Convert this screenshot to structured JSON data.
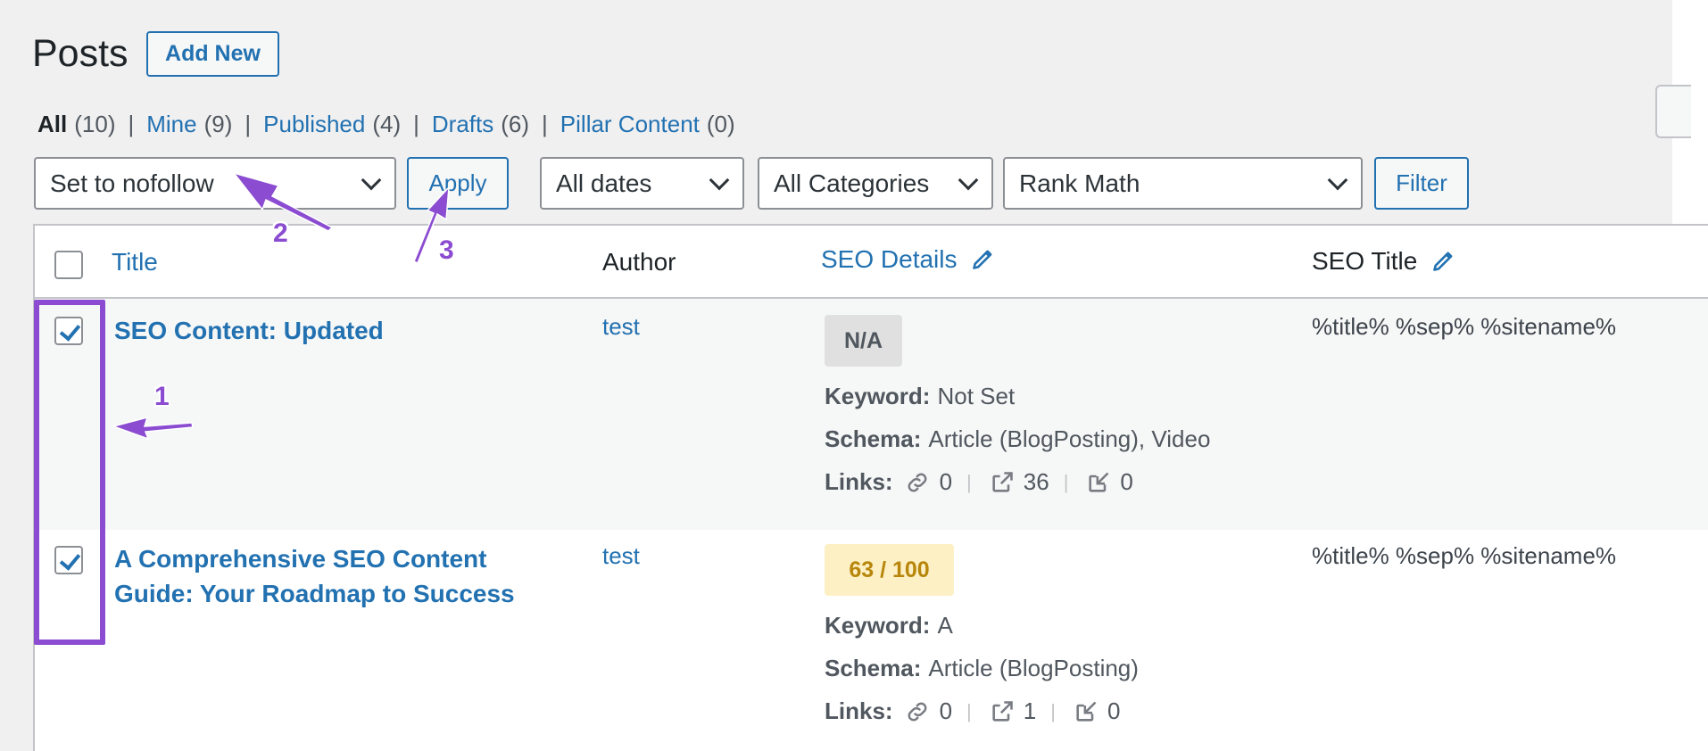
{
  "header": {
    "title": "Posts",
    "add_new_label": "Add New"
  },
  "views": [
    {
      "label": "All",
      "count": "(10)"
    },
    {
      "label": "Mine",
      "count": "(9)"
    },
    {
      "label": "Published",
      "count": "(4)"
    },
    {
      "label": "Drafts",
      "count": "(6)"
    },
    {
      "label": "Pillar Content",
      "count": "(0)"
    }
  ],
  "tablenav": {
    "bulk_action": "Set to nofollow",
    "apply_label": "Apply",
    "dates": "All dates",
    "categories": "All Categories",
    "seo_filter": "Rank Math",
    "filter_label": "Filter"
  },
  "table": {
    "columns": {
      "title": "Title",
      "author": "Author",
      "seo_details": "SEO Details",
      "seo_title": "SEO Title"
    },
    "rows": [
      {
        "checked": true,
        "title_lines": [
          "SEO Content: Updated"
        ],
        "author": "test",
        "score": "N/A",
        "keyword_label": "Keyword:",
        "keyword": "Not Set",
        "schema_label": "Schema:",
        "schema": "Article (BlogPosting), Video",
        "links_label": "Links:",
        "internal": "0",
        "external": "36",
        "incoming": "0",
        "seo_title": "%title% %sep% %sitename%"
      },
      {
        "checked": true,
        "title_lines": [
          "A Comprehensive SEO Content",
          "Guide: Your Roadmap to Success"
        ],
        "author": "test",
        "score": "63 / 100",
        "keyword_label": "Keyword:",
        "keyword": "A",
        "schema_label": "Schema:",
        "schema": "Article (BlogPosting)",
        "links_label": "Links:",
        "internal": "0",
        "external": "1",
        "incoming": "0",
        "seo_title": "%title% %sep% %sitename%"
      }
    ]
  },
  "annotations": {
    "step1": "1",
    "step2": "2",
    "step3": "3",
    "color": "#8b4cd1"
  },
  "icons": {
    "link": "link-icon",
    "external": "external-link-icon",
    "incoming": "incoming-link-icon",
    "pencil": "pencil-icon"
  }
}
